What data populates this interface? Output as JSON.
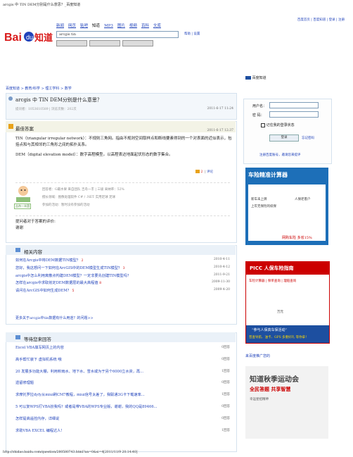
{
  "window": {
    "title": "arcgis 中 TIN DEM分别是什么意思？_百度知道"
  },
  "top_links": "百度首页 | 百度知道 | 登录 | 注册",
  "nav": {
    "items": [
      "新闻",
      "网页",
      "贴吧",
      "知道",
      "MP3",
      "图片",
      "视频",
      "百科",
      "文库"
    ],
    "current": "知道"
  },
  "search": {
    "value": "arcgis  tin",
    "help": "帮助 | 设置"
  },
  "breadcrumb": "百度知道 > 教育/科学 > 理工学科 > 数学",
  "question": {
    "title": "arcgis 中 TIN DEM分别是什么意思？",
    "meta": "提问者：1053610589  |  浏览次数：202次",
    "date": "2011-6-17 11:24"
  },
  "best_answer": {
    "label": "最佳答案",
    "date": "2011-6-17 12:37",
    "paragraphs": [
      "TIN（triangular irregular network）：不规则三角网。指由不规则空间取样点和断线要素得到的一个对表面的近似表示，包括点和与其相邻的三角形之间的拓扑关系。",
      "DEM（digital elevation model）：数字高程模型。以高程表达地面起伏形态的数字集合。"
    ],
    "vote_count": "2",
    "comment": "评论",
    "answerer_lines": [
      "回答者：G最水果  来自团队 吉舟一丰  | 三级  采纳率：52%",
      "擅长领域：图像处理软件  C# / .NET  实用足球  足球",
      "参加的活动：暂时没有参加的活动"
    ],
    "answerer_name": "G最水果",
    "avatar_label": "吉舟一丰团",
    "eval_title": "提问者对于答案的评价:",
    "eval_text": "谢谢"
  },
  "related": {
    "title": "相关内容",
    "items": [
      {
        "text": "如何在Arcgis中将DEM数据TIN模型？",
        "count": "2",
        "date": "2010-4-11"
      },
      {
        "text": "您好，我这想问一下如何在ArcGIS中的DEM模型生成TIN模型？",
        "count": "3",
        "date": "2010-4-12"
      },
      {
        "text": "arcgis中怎么利用离散点构建DEM模型？一定非要先创建TIN模型吗？",
        "count": "",
        "date": "2011-9-21"
      },
      {
        "text": "怎样在arcgis中求取划定DEM数据层的最大高程值",
        "count": "8",
        "date": "2009-11-30"
      },
      {
        "text": "请问在ArcGIS中如何生成DEM？",
        "count": "5",
        "date": "2009-4-20"
      }
    ],
    "more": "更多关于arcgis中tin数据有什么用途？的问题>>"
  },
  "waiting": {
    "title": "等待您来回答",
    "items": [
      {
        "text": "Excel VBA填写网页上的内容",
        "count": "0回答"
      },
      {
        "text": "高手帮忙装下 虚拟机系统 哦",
        "count": "0回答"
      },
      {
        "text": "20 发展多功能大棚，利用积雨水、地下水、雪水或为于另个6000立水资，再...",
        "count": "1回答"
      },
      {
        "text": "遗留修理题",
        "count": "0回答"
      },
      {
        "text": "求摩托罗拉dyfy从miui刷CM7教程，miui信号太差了，我联通3G卡下载速率...",
        "count": "1回答"
      },
      {
        "text": "5 可以复WPS打VBA扮我吗？或者是带VBA的WPS专业版，谢谢，我的QQ是89466...",
        "count": "0回答"
      },
      {
        "text": "怎样提高遥控内存，详细说",
        "count": "0回答"
      },
      {
        "text": "求助VBA EXCEL 编程达人!",
        "count": "1回答"
      }
    ]
  },
  "status_url": "http://zhidao.baidu.com/question/280580743.html?an=0&si=4[2011/11/9 20:14:40]",
  "sidebar": {
    "head": "百度知道",
    "login": {
      "user_label": "用户名：",
      "pass_label": "密  码：",
      "remember": "记住我的登录状态",
      "login_btn": "登录",
      "forgot": "忘记密码",
      "register": "注册百度账号，邀请您来提评"
    },
    "ad1": {
      "title": "车险精准计算器",
      "opt1": "新车未上牌",
      "opt2": "上年无保险的续保",
      "opt3": "人保老客户",
      "footer": "网购车险 多省15%"
    },
    "ad2": {
      "brand": "PICC 人保车险指南",
      "row": "车险计算器 | 保单查询 | 理赔查询",
      "unit": "万元",
      "slogan": "“参与人保真车保活动”",
      "sub": "普查导航、油卡、GPS 多重好礼 等你拿！"
    },
    "ad_link": "来百度推广您的",
    "ad3": {
      "title": "知道秋季运动会",
      "sub": "全民答题 共享智慧",
      "small": "幸运星招精神"
    }
  },
  "colors": {
    "link": "#2244bb",
    "accent": "#c00000",
    "panel": "#eaf1f8"
  }
}
